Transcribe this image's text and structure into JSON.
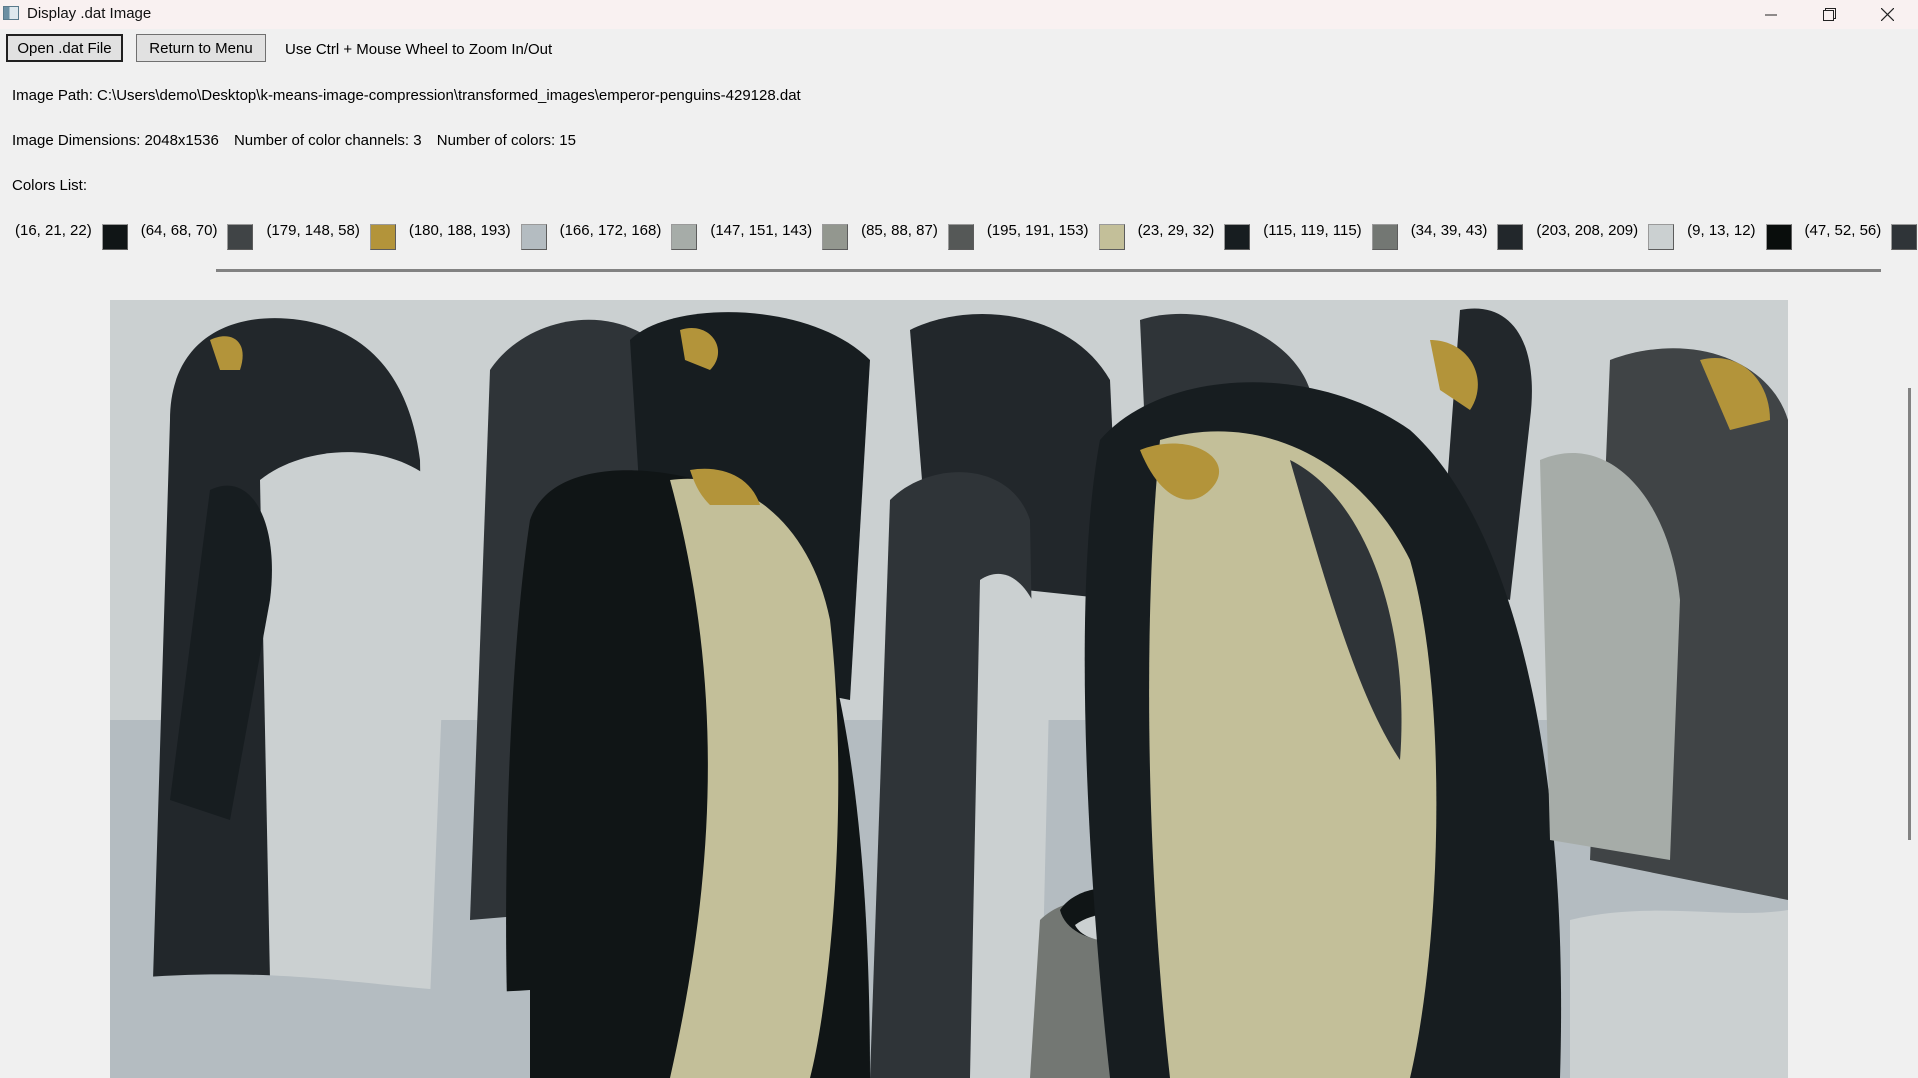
{
  "window": {
    "title": "Display .dat Image"
  },
  "toolbar": {
    "open_label": "Open .dat File",
    "menu_label": "Return to Menu",
    "zoom_hint": "Use Ctrl + Mouse Wheel to Zoom In/Out"
  },
  "info": {
    "path": "Image Path: C:\\Users\\demo\\Desktop\\k-means-image-compression\\transformed_images\\emperor-penguins-429128.dat",
    "dimensions": "Image Dimensions: 2048x1536",
    "channels": "Number of color channels: 3",
    "num_colors": "Number of colors: 15",
    "colors_label": "Colors List:"
  },
  "colors": [
    {
      "label": "(16, 21, 22)",
      "hex": "#101516"
    },
    {
      "label": "(64, 68, 70)",
      "hex": "#404446"
    },
    {
      "label": "(179, 148, 58)",
      "hex": "#b3943a"
    },
    {
      "label": "(180, 188, 193)",
      "hex": "#b4bcc1"
    },
    {
      "label": "(166, 172, 168)",
      "hex": "#a6aca8"
    },
    {
      "label": "(147, 151, 143)",
      "hex": "#93978f"
    },
    {
      "label": "(85, 88, 87)",
      "hex": "#555857"
    },
    {
      "label": "(195, 191, 153)",
      "hex": "#c3bf99"
    },
    {
      "label": "(23, 29, 32)",
      "hex": "#171d20"
    },
    {
      "label": "(115, 119, 115)",
      "hex": "#737773"
    },
    {
      "label": "(34, 39, 43)",
      "hex": "#22272b"
    },
    {
      "label": "(203, 208, 209)",
      "hex": "#cbd0d1"
    },
    {
      "label": "(9, 13, 12)",
      "hex": "#090d0c"
    },
    {
      "label": "(47, 52, 56)",
      "hex": "#2f3438"
    }
  ]
}
